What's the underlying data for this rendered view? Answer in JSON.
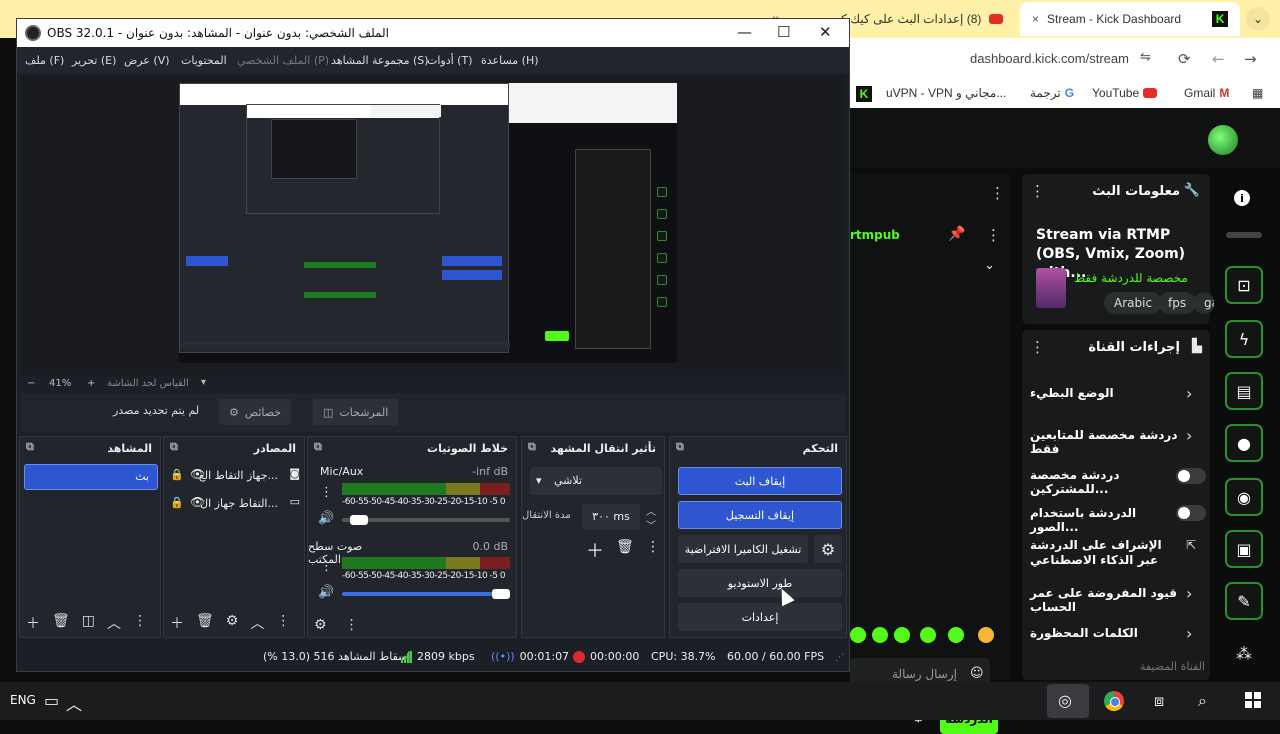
{
  "browser": {
    "tab_inactive_title": "(8) إعدادات البث على كيك كي...",
    "tab_active_title": "Stream - Kick Dashboard",
    "tab_close": "×",
    "menu_glyph": "⌄",
    "url": "dashboard.kick.com/stream",
    "bookmarks": [
      {
        "label": "Gmail",
        "icon": "gmail-icon"
      },
      {
        "label": "YouTube",
        "icon": "youtube-icon"
      },
      {
        "label": "ترجمة",
        "icon": "translate-icon"
      },
      {
        "label": "uVPN - VPN مجاني و...",
        "icon": "vpn-icon"
      }
    ]
  },
  "kick": {
    "stream_info_title": "معلومات البث",
    "stream_title": "Stream via RTMP (OBS, Vmix, Zoom) with...",
    "category_label": "مخصصة للدردشة فقط",
    "tags": [
      "Arabic",
      "fps",
      "gar"
    ],
    "channel_actions_title": "إجراءات القناة",
    "actions": [
      {
        "label": "الوضع البطيء",
        "kind": "chevron"
      },
      {
        "label": "دردشة مخصصة للمتابعين فقط",
        "kind": "chevron"
      },
      {
        "label": "دردشة مخصصة للمشتركين...",
        "kind": "toggle"
      },
      {
        "label": "الدردشة باستخدام الصور...",
        "kind": "toggle"
      },
      {
        "label": "الإشراف على الدردشة عبر الذكاء الاصطناعي",
        "kind": "link"
      },
      {
        "label": "قيود المفروضة على عمر الحساب",
        "kind": "chevron"
      },
      {
        "label": "الكلمات المحظورة",
        "kind": "chevron"
      }
    ],
    "chat_rtmp_fragment": "rtmpub",
    "chat_input_placeholder": "إرسال رسالة",
    "chat_button": "الدردشة",
    "footer_hint": "القناة المضيفة"
  },
  "obs": {
    "window_title": "OBS 32.0.1 - الملف الشخصي: بدون عنوان - المشاهد: بدون عنوان",
    "menu": [
      {
        "label": "ملف (F)",
        "disabled": false
      },
      {
        "label": "تحرير (E)",
        "disabled": false
      },
      {
        "label": "عرض (V)",
        "disabled": false
      },
      {
        "label": "المحتويات",
        "disabled": false
      },
      {
        "label": "الملف الشخصي (P)",
        "disabled": true
      },
      {
        "label": "مجموعة المشاهد (S)",
        "disabled": false
      },
      {
        "label": "أدوات (T)",
        "disabled": false
      },
      {
        "label": "مساعدة (H)",
        "disabled": false
      }
    ],
    "zoom": "41%",
    "zoom_fit_label": "القياس لحد الشاشة",
    "no_source_selected": "لم يتم تحديد مصدر",
    "properties_btn": "خصائص",
    "filters_btn": "المرشحات",
    "docks": {
      "scenes": {
        "title": "المشاهد",
        "items": [
          "بث"
        ]
      },
      "sources": {
        "title": "المصادر",
        "items": [
          "جهاز التقاط الع...",
          "التقاط جهاز ال..."
        ]
      },
      "mixer": {
        "title": "خلاط الصوتيات",
        "channels": [
          {
            "name": "Mic/Aux",
            "db": "-inf dB",
            "level": 0.05
          },
          {
            "name": "صوت سطح المكتب",
            "db": "0.0 dB",
            "level": 1.0
          }
        ],
        "scale": "-60-55-50-45-40-35-30-25-20-15-10 -5 0"
      },
      "transitions": {
        "title": "تأثير انتقال المشهد",
        "selected": "تلاشي",
        "duration_label": "مدة الانتقال",
        "duration": "٣٠٠ ms"
      },
      "controls": {
        "title": "التحكم",
        "buttons": [
          "إيقاف البث",
          "إيقاف التسجيل",
          "تشغيل الكاميرا الافتراضية",
          "طور الاستوديو",
          "إعدادات"
        ]
      }
    },
    "status": {
      "dropped": "إسقاط المشاهد 516 (13.0 %)",
      "bitrate": "2809 kbps",
      "stream_time": "00:01:07",
      "rec_time": "00:00:00",
      "cpu": "CPU: 38.7%",
      "fps": "60.00 / 60.00 FPS"
    }
  },
  "taskbar": {
    "lang": "ENG"
  },
  "colors": {
    "kick_green": "#53fc18",
    "obs_blue": "#2e56d1",
    "rec_red": "#e0282e"
  }
}
